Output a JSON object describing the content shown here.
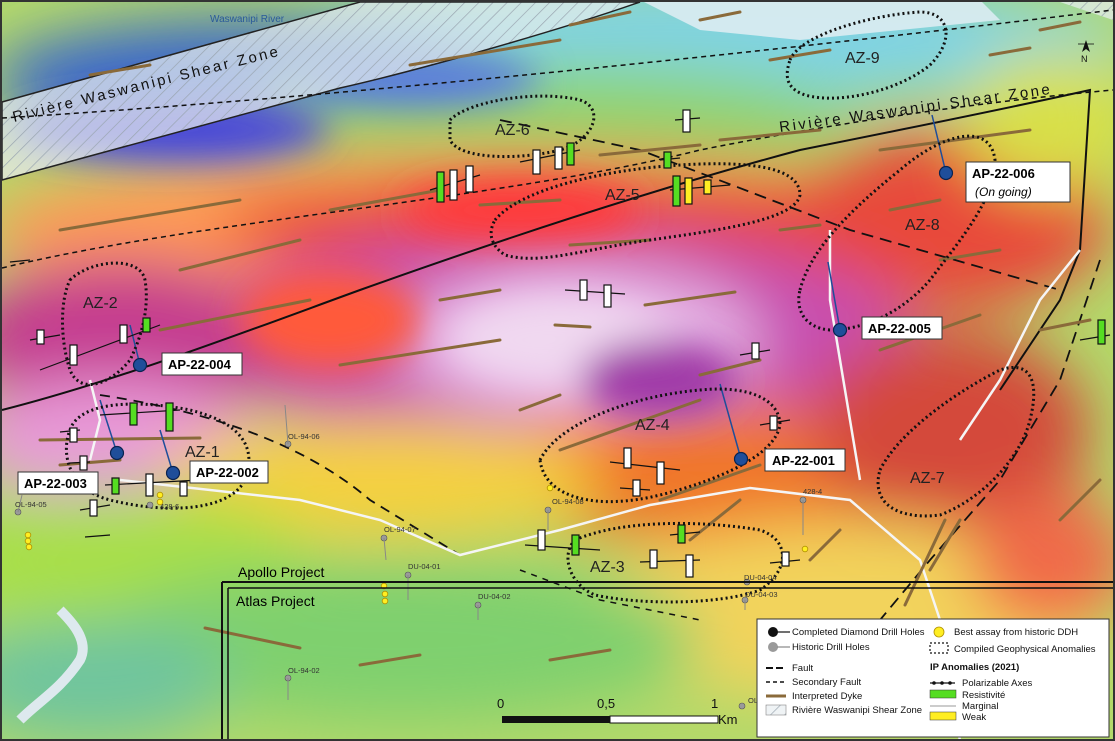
{
  "river_label": "Waswanipi River",
  "shear_zone_label": "Rivière Waswanipi Shear Zone",
  "north_label": "N",
  "anomaly_labels": [
    "AZ-1",
    "AZ-2",
    "AZ-3",
    "AZ-4",
    "AZ-5",
    "AZ-6",
    "AZ-7",
    "AZ-8",
    "AZ-9"
  ],
  "planned_holes": [
    {
      "id": "AP-22-001",
      "note": ""
    },
    {
      "id": "AP-22-002",
      "note": ""
    },
    {
      "id": "AP-22-003",
      "note": ""
    },
    {
      "id": "AP-22-004",
      "note": ""
    },
    {
      "id": "AP-22-005",
      "note": ""
    },
    {
      "id": "AP-22-006",
      "note": "(On going)"
    }
  ],
  "historic_holes": [
    "OL-94-06",
    "OL-94-05",
    "428-6",
    "OL-94-08",
    "OL-94-07",
    "DU-04-01",
    "DU-04-02",
    "DU-04-03",
    "DU-04-04",
    "428-4",
    "OL-94-02",
    "OL"
  ],
  "project_labels": {
    "apollo": "Apollo Project",
    "atlas": "Atlas Project"
  },
  "scale": {
    "ticks": [
      "0",
      "0,5",
      "1"
    ],
    "unit": "Km"
  },
  "legend": {
    "completed_holes": "Completed Diamond Drill Holes",
    "historic_holes": "Historic Drill Holes",
    "best_assay": "Best assay from historic DDH",
    "geophys": "Compiled Geophysical Anomalies",
    "fault": "Fault",
    "secondary_fault": "Secondary Fault",
    "dyke": "Interpreted Dyke",
    "shear": "Rivière Waswanipi Shear Zone",
    "ip_title": "IP Anomalies (2021)",
    "polarizable": "Polarizable Axes",
    "resistivite": "Resistivité",
    "marginal": "Marginal",
    "weak": "Weak"
  },
  "colors": {
    "resistivite": "#55dd22",
    "weak": "#ffee22",
    "drill_blue": "#1f4e9a",
    "dyke": "#8a6a3a"
  }
}
